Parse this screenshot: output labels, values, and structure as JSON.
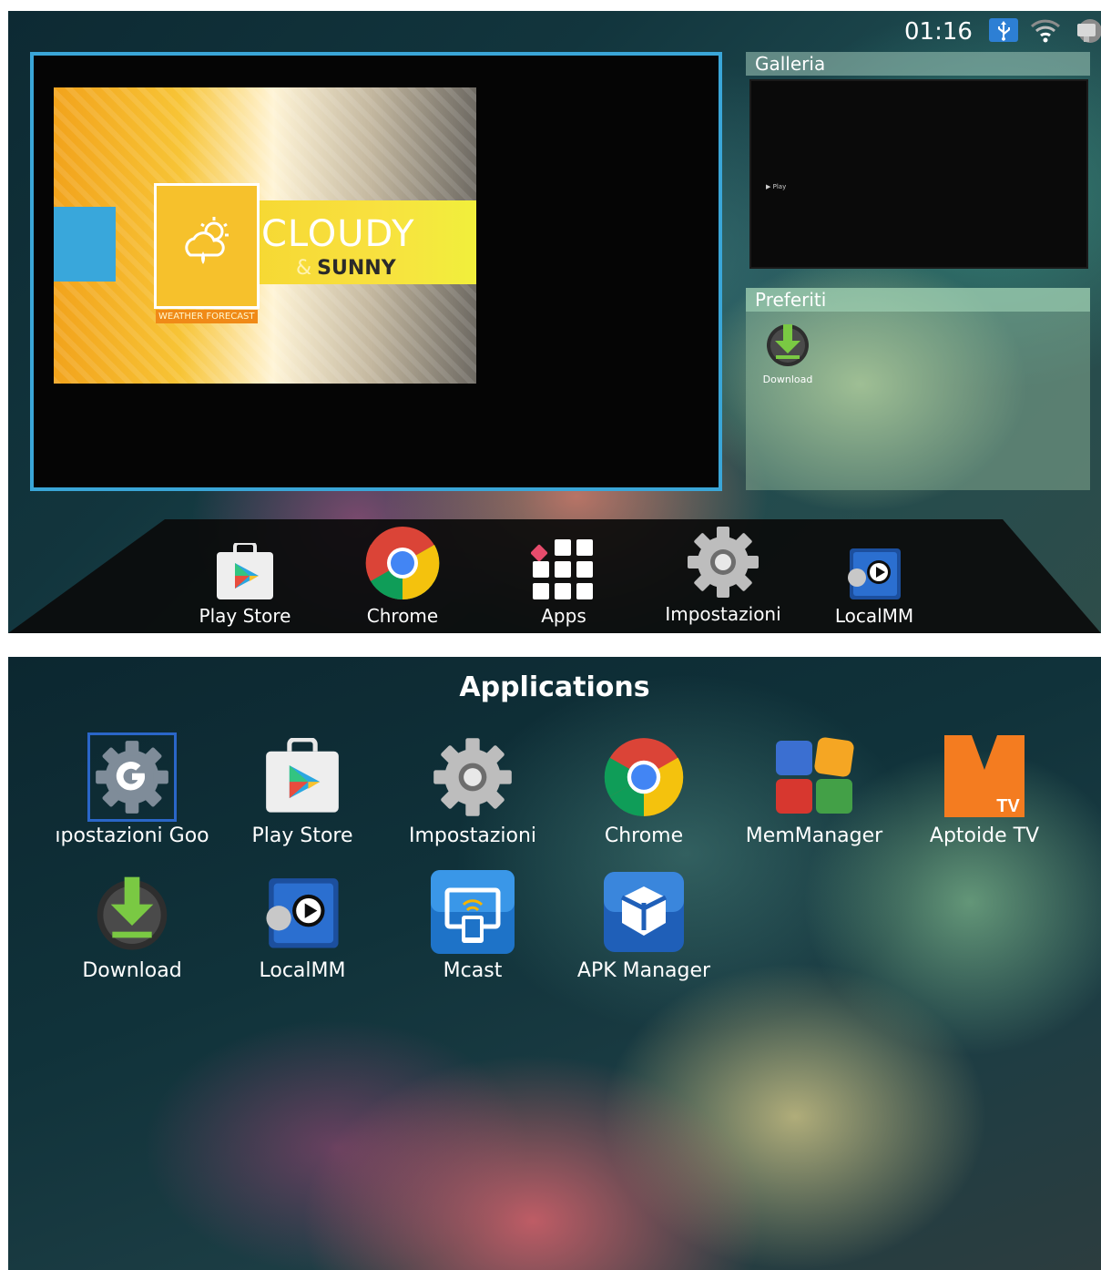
{
  "home": {
    "status_bar": {
      "time": "01:16",
      "icons": [
        "usb-icon",
        "wifi-icon",
        "monitor-icon"
      ]
    },
    "video": {
      "headline": "CLOUDY",
      "amp": "&",
      "subline": "SUNNY",
      "tag": "WEATHER FORECAST"
    },
    "gallery": {
      "title": "Galleria",
      "play_label": "▶ Play"
    },
    "favorites": {
      "title": "Preferiti",
      "items": [
        {
          "label": "Download",
          "icon": "download-icon"
        }
      ]
    },
    "dock": [
      {
        "label": "Play Store",
        "icon": "play-store-icon"
      },
      {
        "label": "Chrome",
        "icon": "chrome-icon"
      },
      {
        "label": "Apps",
        "icon": "apps-grid-icon"
      },
      {
        "label": "Impostazioni",
        "icon": "settings-gear-icon"
      },
      {
        "label": "LocalMM",
        "icon": "localmm-icon"
      }
    ]
  },
  "apps": {
    "title": "Applications",
    "items": [
      {
        "label": "ıpostazioni Goo",
        "icon": "google-settings-icon",
        "focused": true
      },
      {
        "label": "Play Store",
        "icon": "play-store-icon"
      },
      {
        "label": "Impostazioni",
        "icon": "settings-gear-icon"
      },
      {
        "label": "Chrome",
        "icon": "chrome-icon"
      },
      {
        "label": "MemManager",
        "icon": "memmanager-icon"
      },
      {
        "label": "Aptoide TV",
        "icon": "aptoide-tv-icon"
      },
      {
        "label": "Download",
        "icon": "download-icon"
      },
      {
        "label": "LocalMM",
        "icon": "localmm-icon"
      },
      {
        "label": "Mcast",
        "icon": "mcast-icon"
      },
      {
        "label": "APK Manager",
        "icon": "apk-manager-icon"
      }
    ]
  },
  "colors": {
    "focus_border": "#3aa6d8",
    "selection_outline": "#2a66c8",
    "usb_badge": "#2d7fd4"
  }
}
